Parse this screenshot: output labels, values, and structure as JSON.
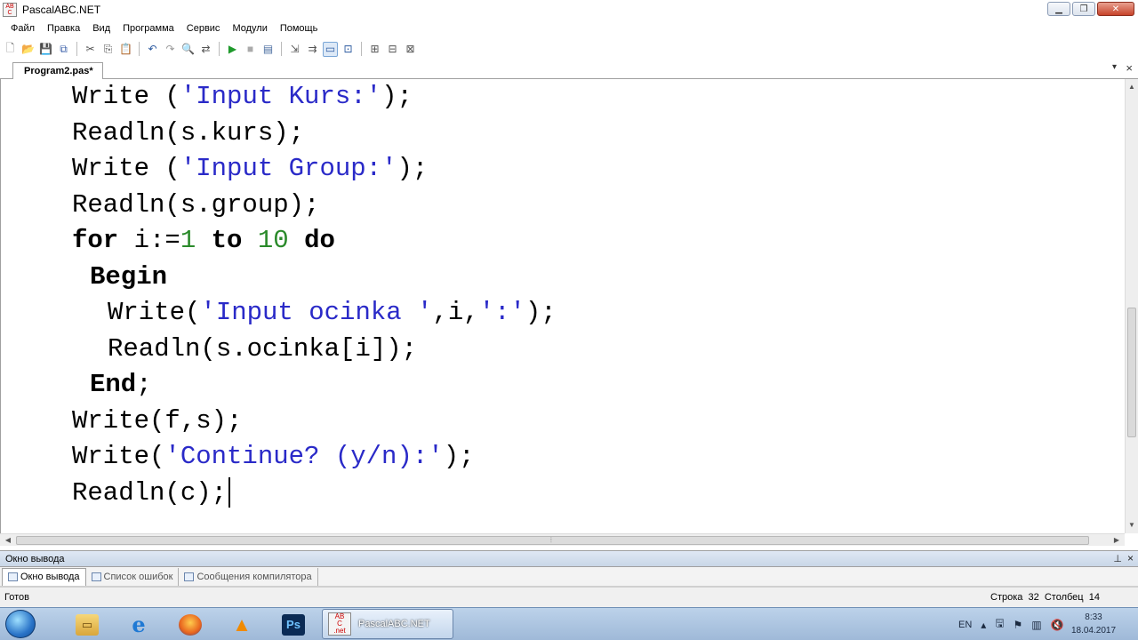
{
  "window": {
    "title": "PascalABC.NET",
    "icon_text": "ABC",
    "controls": [
      "minimize-icon",
      "maximize-icon",
      "close-icon"
    ]
  },
  "menu": {
    "items": [
      "Файл",
      "Правка",
      "Вид",
      "Программа",
      "Сервис",
      "Модули",
      "Помощь"
    ]
  },
  "toolbar": {
    "buttons": [
      "new-file-icon",
      "open-icon",
      "save-icon",
      "save-all-icon",
      "cut-icon",
      "copy-icon",
      "paste-icon",
      "undo-icon",
      "redo-icon",
      "find-icon",
      "replace-icon",
      "run-icon",
      "stop-icon",
      "compile-icon",
      "step-into-icon",
      "step-over-icon",
      "output-window-icon",
      "debug-icon",
      "watch-icon",
      "locals-icon",
      "breakpoints-icon"
    ],
    "active_button": "output-window-icon"
  },
  "tabs": {
    "active": "Program2.pas*",
    "dropdown_glyph": "▾",
    "close_glyph": "×"
  },
  "editor": {
    "lines": [
      {
        "indent": 0,
        "parts": [
          {
            "t": "Write ("
          },
          {
            "t": "'Input Kurs:'",
            "c": "str"
          },
          {
            "t": ");"
          }
        ]
      },
      {
        "indent": 0,
        "parts": [
          {
            "t": "Readln(s.kurs);"
          }
        ]
      },
      {
        "indent": 0,
        "parts": [
          {
            "t": "Write ("
          },
          {
            "t": "'Input Group:'",
            "c": "str"
          },
          {
            "t": ");"
          }
        ]
      },
      {
        "indent": 0,
        "parts": [
          {
            "t": "Readln(s.group);"
          }
        ]
      },
      {
        "indent": 0,
        "parts": [
          {
            "t": "for",
            "c": "kw"
          },
          {
            "t": " i:="
          },
          {
            "t": "1",
            "c": "num"
          },
          {
            "t": " "
          },
          {
            "t": "to",
            "c": "kw"
          },
          {
            "t": " "
          },
          {
            "t": "10",
            "c": "num"
          },
          {
            "t": " "
          },
          {
            "t": "do",
            "c": "kw"
          }
        ]
      },
      {
        "indent": 1,
        "parts": [
          {
            "t": "Begin",
            "c": "kw"
          }
        ]
      },
      {
        "indent": 2,
        "parts": [
          {
            "t": "Write("
          },
          {
            "t": "'Input ocinka '",
            "c": "str"
          },
          {
            "t": ",i,"
          },
          {
            "t": "':'",
            "c": "str"
          },
          {
            "t": ");"
          }
        ]
      },
      {
        "indent": 2,
        "parts": [
          {
            "t": "Readln(s.ocinka[i]);"
          }
        ]
      },
      {
        "indent": 1,
        "parts": [
          {
            "t": "End",
            "c": "kw"
          },
          {
            "t": ";"
          }
        ]
      },
      {
        "indent": 0,
        "parts": [
          {
            "t": "Write(f,s);"
          }
        ]
      },
      {
        "indent": 0,
        "parts": [
          {
            "t": "Write("
          },
          {
            "t": "'Continue? (y/n):'",
            "c": "str"
          },
          {
            "t": ");"
          }
        ]
      },
      {
        "indent": 0,
        "parts": [
          {
            "t": "Readln(c);"
          }
        ],
        "caret": true
      }
    ],
    "colors": {
      "keyword": "#000000",
      "string": "#2a2ac8",
      "number": "#2a8a2a"
    }
  },
  "output_panel": {
    "title": "Окно вывода",
    "pin_glyph": "📌",
    "close_glyph": "×",
    "tabs": [
      "Окно вывода",
      "Список ошибок",
      "Сообщения компилятора"
    ],
    "active_tab": "Окно вывода"
  },
  "status": {
    "ready": "Готов",
    "position": "Строка  32  Столбец  14"
  },
  "taskbar": {
    "pinned": [
      "explorer-icon",
      "internet-explorer-icon",
      "firefox-icon",
      "vlc-icon",
      "photoshop-icon"
    ],
    "active_app": "PascalABC.NET",
    "language": "EN",
    "clock_time": "8:33",
    "clock_date": "18.04.2017"
  }
}
